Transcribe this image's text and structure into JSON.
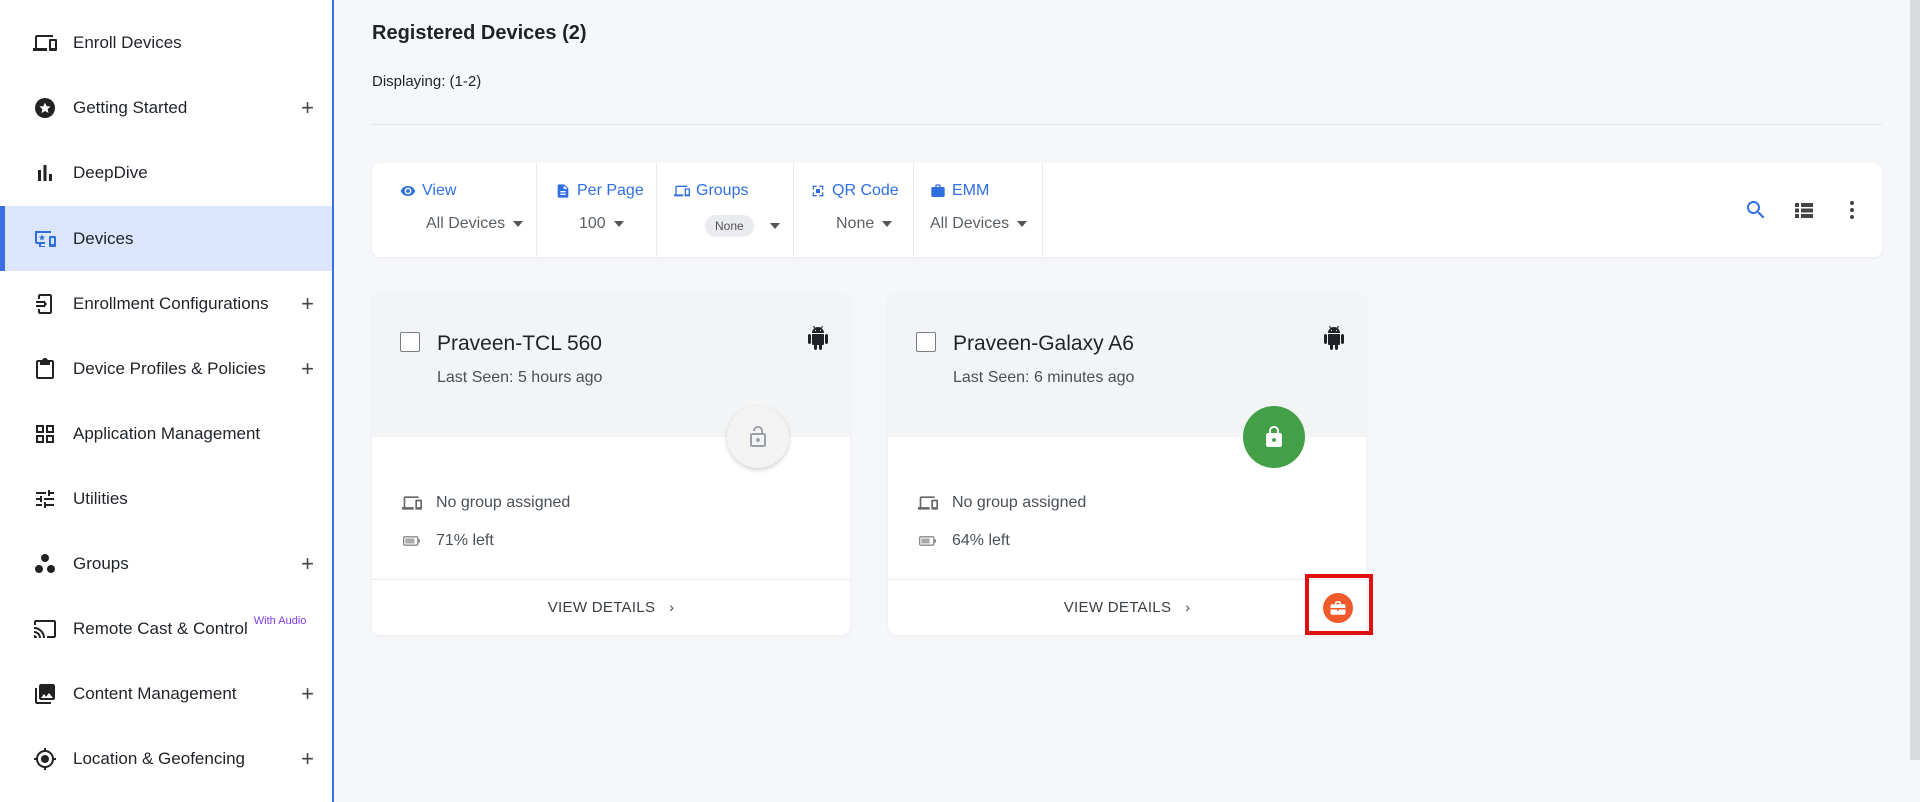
{
  "sidebar": {
    "items": [
      {
        "label": "Enroll Devices",
        "icon": "devices-icon",
        "expandable": false
      },
      {
        "label": "Getting Started",
        "icon": "star-badge-icon",
        "expandable": true
      },
      {
        "label": "DeepDive",
        "icon": "bar-chart-icon",
        "expandable": false
      },
      {
        "label": "Devices",
        "icon": "device-monitor-icon",
        "expandable": false,
        "active": true
      },
      {
        "label": "Enrollment Configurations",
        "icon": "phone-config-icon",
        "expandable": true
      },
      {
        "label": "Device Profiles & Policies",
        "icon": "clipboard-icon",
        "expandable": true
      },
      {
        "label": "Application Management",
        "icon": "grid-icon",
        "expandable": false
      },
      {
        "label": "Utilities",
        "icon": "sliders-icon",
        "expandable": false
      },
      {
        "label": "Groups",
        "icon": "groups-icon",
        "expandable": true
      },
      {
        "label": "Remote Cast & Control",
        "icon": "cast-icon",
        "expandable": false,
        "badge": "With Audio"
      },
      {
        "label": "Content Management",
        "icon": "photo-library-icon",
        "expandable": true
      },
      {
        "label": "Location & Geofencing",
        "icon": "location-target-icon",
        "expandable": true
      }
    ],
    "plus_symbol": "+"
  },
  "main": {
    "title": "Registered Devices (2)",
    "displaying": "Displaying: (1-2)"
  },
  "toolbar": {
    "view": {
      "label": "View",
      "value": "All Devices"
    },
    "per_page": {
      "label": "Per Page",
      "value": "100"
    },
    "groups": {
      "label": "Groups",
      "value": "None"
    },
    "qr_code": {
      "label": "QR Code",
      "value": "None"
    },
    "emm": {
      "label": "EMM",
      "value": "All Devices"
    }
  },
  "devices": [
    {
      "name": "Praveen-TCL 560",
      "last_seen": "Last Seen: 5 hours ago",
      "group": "No group assigned",
      "battery": "71% left",
      "locked": false,
      "view_details": "VIEW DETAILS"
    },
    {
      "name": "Praveen-Galaxy A6",
      "last_seen": "Last Seen: 6 minutes ago",
      "group": "No group assigned",
      "battery": "64% left",
      "locked": true,
      "view_details": "VIEW DETAILS"
    }
  ],
  "colors": {
    "accent": "#2f6fe0",
    "active_bg": "#dbe5fb",
    "locked_green": "#43a047",
    "briefcase_orange": "#ef5a2a",
    "highlight_red": "#e01010"
  }
}
